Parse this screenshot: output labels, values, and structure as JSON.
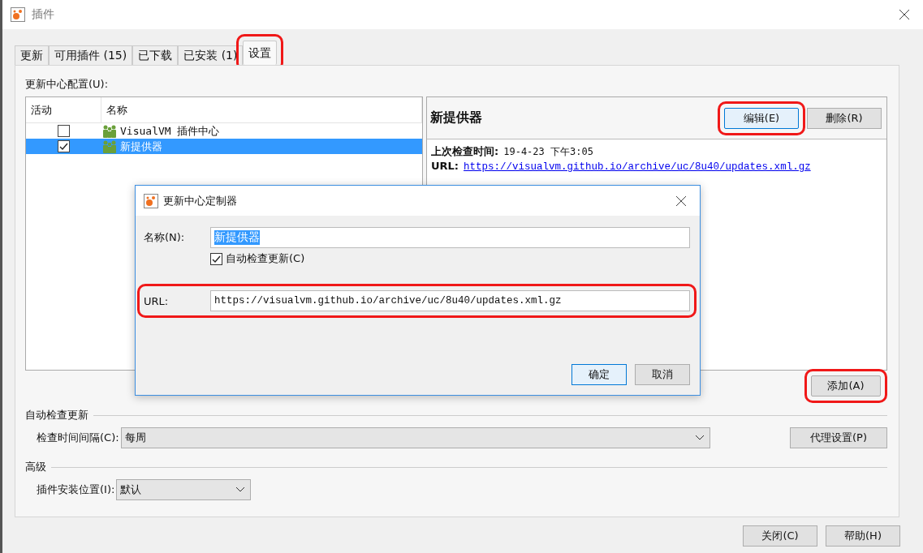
{
  "window": {
    "title": "插件"
  },
  "tabs": [
    {
      "label": "更新",
      "selected": false,
      "highlighted": false
    },
    {
      "label": "可用插件 (15)",
      "selected": false,
      "highlighted": false
    },
    {
      "label": "已下载",
      "selected": false,
      "highlighted": false
    },
    {
      "label": "已安装 (1)",
      "selected": false,
      "highlighted": false
    },
    {
      "label": "设置",
      "selected": true,
      "highlighted": true
    }
  ],
  "update_center": {
    "label": "更新中心配置(U):",
    "columns": [
      "活动",
      "名称"
    ],
    "rows": [
      {
        "checked": false,
        "name": "VisualVM 插件中心",
        "selected": false
      },
      {
        "checked": true,
        "name": "新提供器",
        "selected": true
      }
    ]
  },
  "detail": {
    "title": "新提供器",
    "buttons": [
      {
        "label": "编辑(E)",
        "focused": true,
        "highlighted": true
      },
      {
        "label": "删除(R)",
        "focused": false,
        "highlighted": false
      }
    ],
    "last_check_label": "上次检查时间:",
    "last_check_value": "19-4-23 下午3:05",
    "url_label": "URL:",
    "url": "https://visualvm.github.io/archive/uc/8u40/updates.xml.gz"
  },
  "add_button": {
    "label": "添加(A)",
    "highlighted": true
  },
  "auto_check": {
    "heading": "自动检查更新",
    "interval_label": "检查时间间隔(C):",
    "interval_value": "每周",
    "proxy_button": "代理设置(P)"
  },
  "advanced": {
    "heading": "高级",
    "location_label": "插件安装位置(I):",
    "location_value": "默认"
  },
  "footer_buttons": [
    "关闭(C)",
    "帮助(H)"
  ],
  "dialog": {
    "title": "更新中心定制器",
    "name_label": "名称(N):",
    "name_value": "新提供器",
    "name_text_selected": true,
    "auto_check": {
      "label": "自动检查更新(C)",
      "checked": true
    },
    "url_label": "URL:",
    "url_value": "https://visualvm.github.io/archive/uc/8u40/updates.xml.gz",
    "url_highlighted": true,
    "buttons": [
      {
        "label": "确定",
        "focused": true
      },
      {
        "label": "取消",
        "focused": false
      }
    ]
  }
}
